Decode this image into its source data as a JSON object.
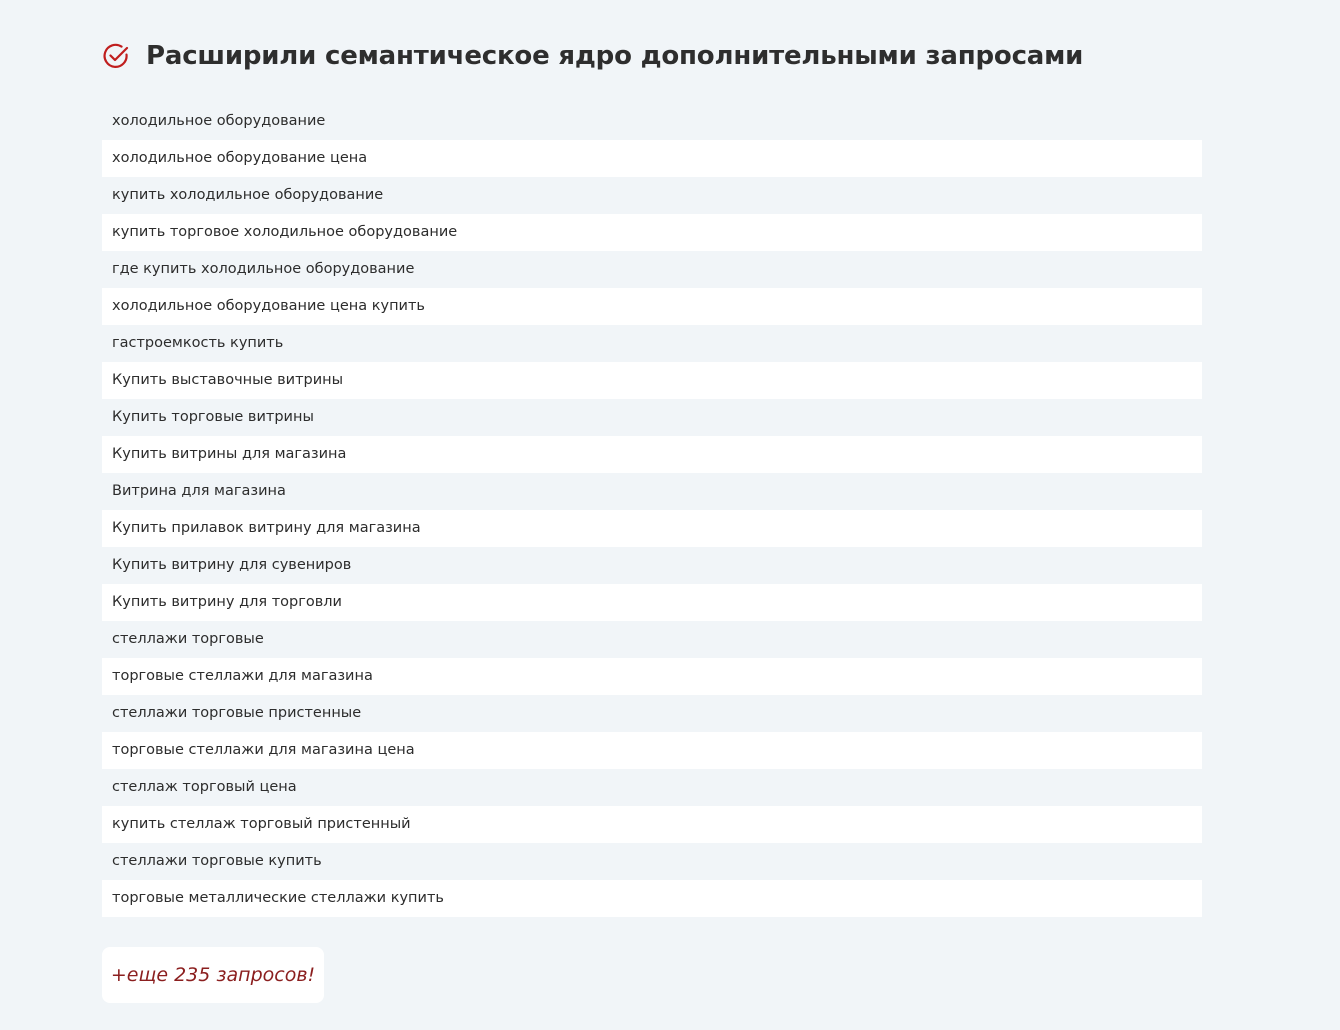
{
  "header": {
    "title": "Расширили семантическое ядро дополнительными запросами",
    "icon": "check-circle-icon",
    "accent_color": "#c01e1e"
  },
  "queries": [
    "холодильное оборудование",
    "холодильное оборудование цена",
    "купить холодильное оборудование",
    "купить торговое холодильное оборудование",
    "где купить холодильное оборудование",
    "холодильное оборудование цена купить",
    "гастроемкость купить",
    "Купить выставочные витрины",
    "Купить торговые витрины",
    "Купить витрины для магазина",
    "Витрина для магазина",
    "Купить прилавок витрину для магазина",
    "Купить витрину для сувениров",
    "Купить витрину для торговли",
    "стеллажи торговые",
    "торговые стеллажи для магазина",
    "стеллажи торговые пристенные",
    "торговые стеллажи для магазина цена",
    "стеллаж торговый цена",
    "купить стеллаж торговый пристенный",
    "стеллажи торговые купить",
    "торговые металлические стеллажи купить"
  ],
  "more": {
    "label": "+еще 235 запросов!",
    "color": "#8b1f1f"
  }
}
